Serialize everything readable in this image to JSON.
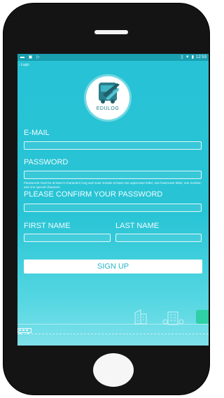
{
  "status_bar": {
    "left_icons": [
      "message-icon",
      "photo-icon",
      "play-store-icon"
    ],
    "right_icons": [
      "vibrate-icon",
      "wifi-icon",
      "battery-icon"
    ],
    "time": "12:53"
  },
  "nav": {
    "back_label": "Login"
  },
  "logo": {
    "text": "EDULOG"
  },
  "form": {
    "email_label": "E-MAIL",
    "email_value": "",
    "password_label": "PASSWORD",
    "password_value": "",
    "password_hint": "Passwords must be at least 8 characters long and must include at least one uppercase letter, one lowercase letter, one number, and one special character.",
    "confirm_label": "PLEASE CONFIRM YOUR PASSWORD",
    "confirm_value": "",
    "first_name_label": "FIRST NAME",
    "first_name_value": "",
    "last_name_label": "LAST NAME",
    "last_name_value": "",
    "signup_label": "SIGN UP"
  },
  "colors": {
    "screen_bg": "#27c2d5",
    "status_bar": "#199fb0",
    "button_text": "#27b6c9",
    "phone_body": "#141414"
  }
}
